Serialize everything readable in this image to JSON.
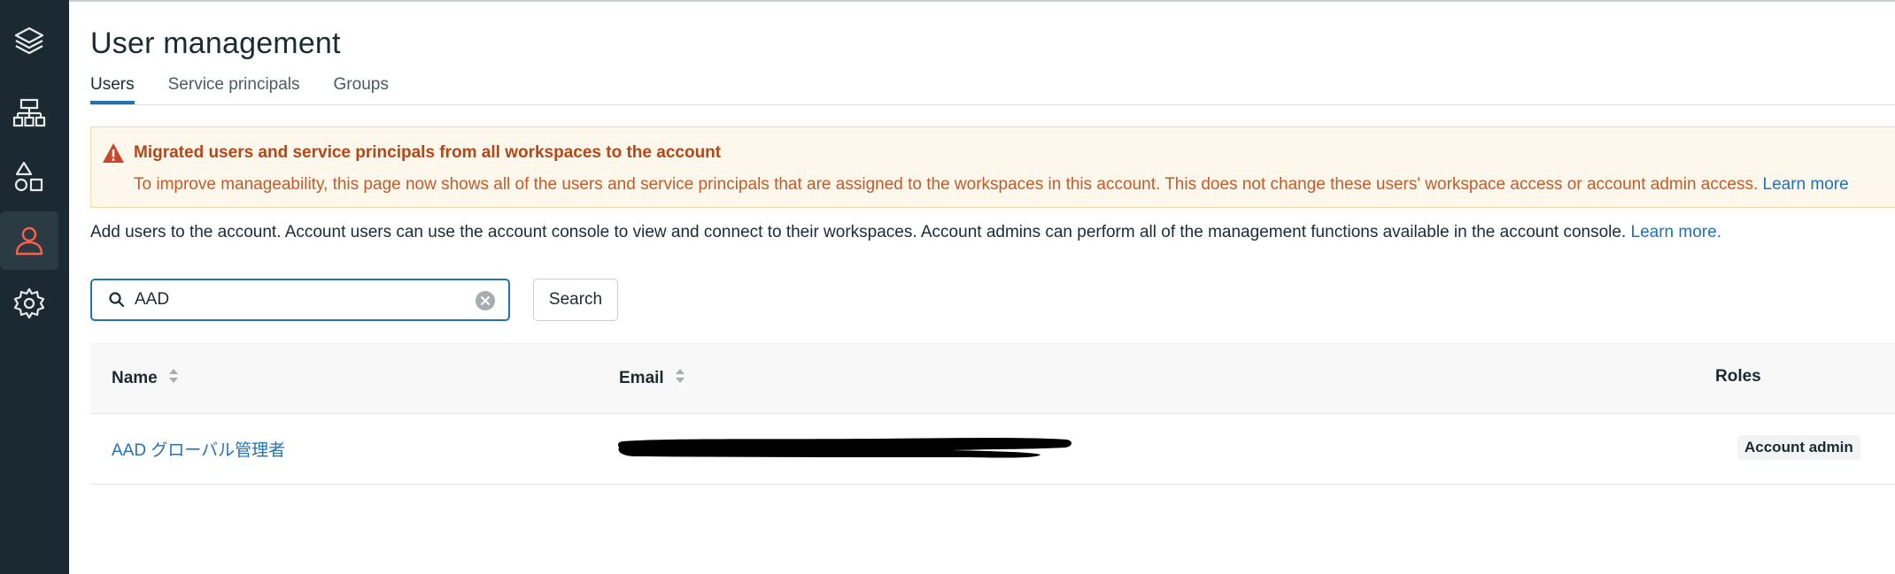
{
  "page": {
    "title": "User management"
  },
  "tabs": [
    {
      "label": "Users",
      "active": true
    },
    {
      "label": "Service principals",
      "active": false
    },
    {
      "label": "Groups",
      "active": false
    }
  ],
  "banner": {
    "title": "Migrated users and service principals from all workspaces to the account",
    "body": "To improve manageability, this page now shows all of the users and service principals that are assigned to the workspaces in this account. This does not change these users' workspace access or account admin access.",
    "link": "Learn more",
    "icon": "warning-triangle-icon"
  },
  "description": {
    "text": "Add users to the account. Account users can use the account console to view and connect to their workspaces. Account admins can perform all of the management functions available in the account console.",
    "link": "Learn more."
  },
  "search": {
    "value": "AAD",
    "button_label": "Search"
  },
  "table": {
    "columns": {
      "name": "Name",
      "email": "Email",
      "roles": "Roles"
    },
    "rows": [
      {
        "name": "AAD グローバル管理者",
        "email": "",
        "role": "Account admin"
      }
    ]
  },
  "sidebar": {
    "items": [
      {
        "icon": "layers-logo-icon"
      },
      {
        "icon": "workspaces-icon"
      },
      {
        "icon": "data-shapes-icon"
      },
      {
        "icon": "user-management-icon",
        "active": true
      },
      {
        "icon": "settings-gear-icon"
      }
    ]
  },
  "colors": {
    "sidebar_bg": "#1b2a32",
    "accent_blue": "#2272b4",
    "warning_bg": "#fef7ec",
    "warning_title": "#b34717",
    "warning_text": "#c25b2b",
    "active_nav_icon": "#ff5f46"
  }
}
